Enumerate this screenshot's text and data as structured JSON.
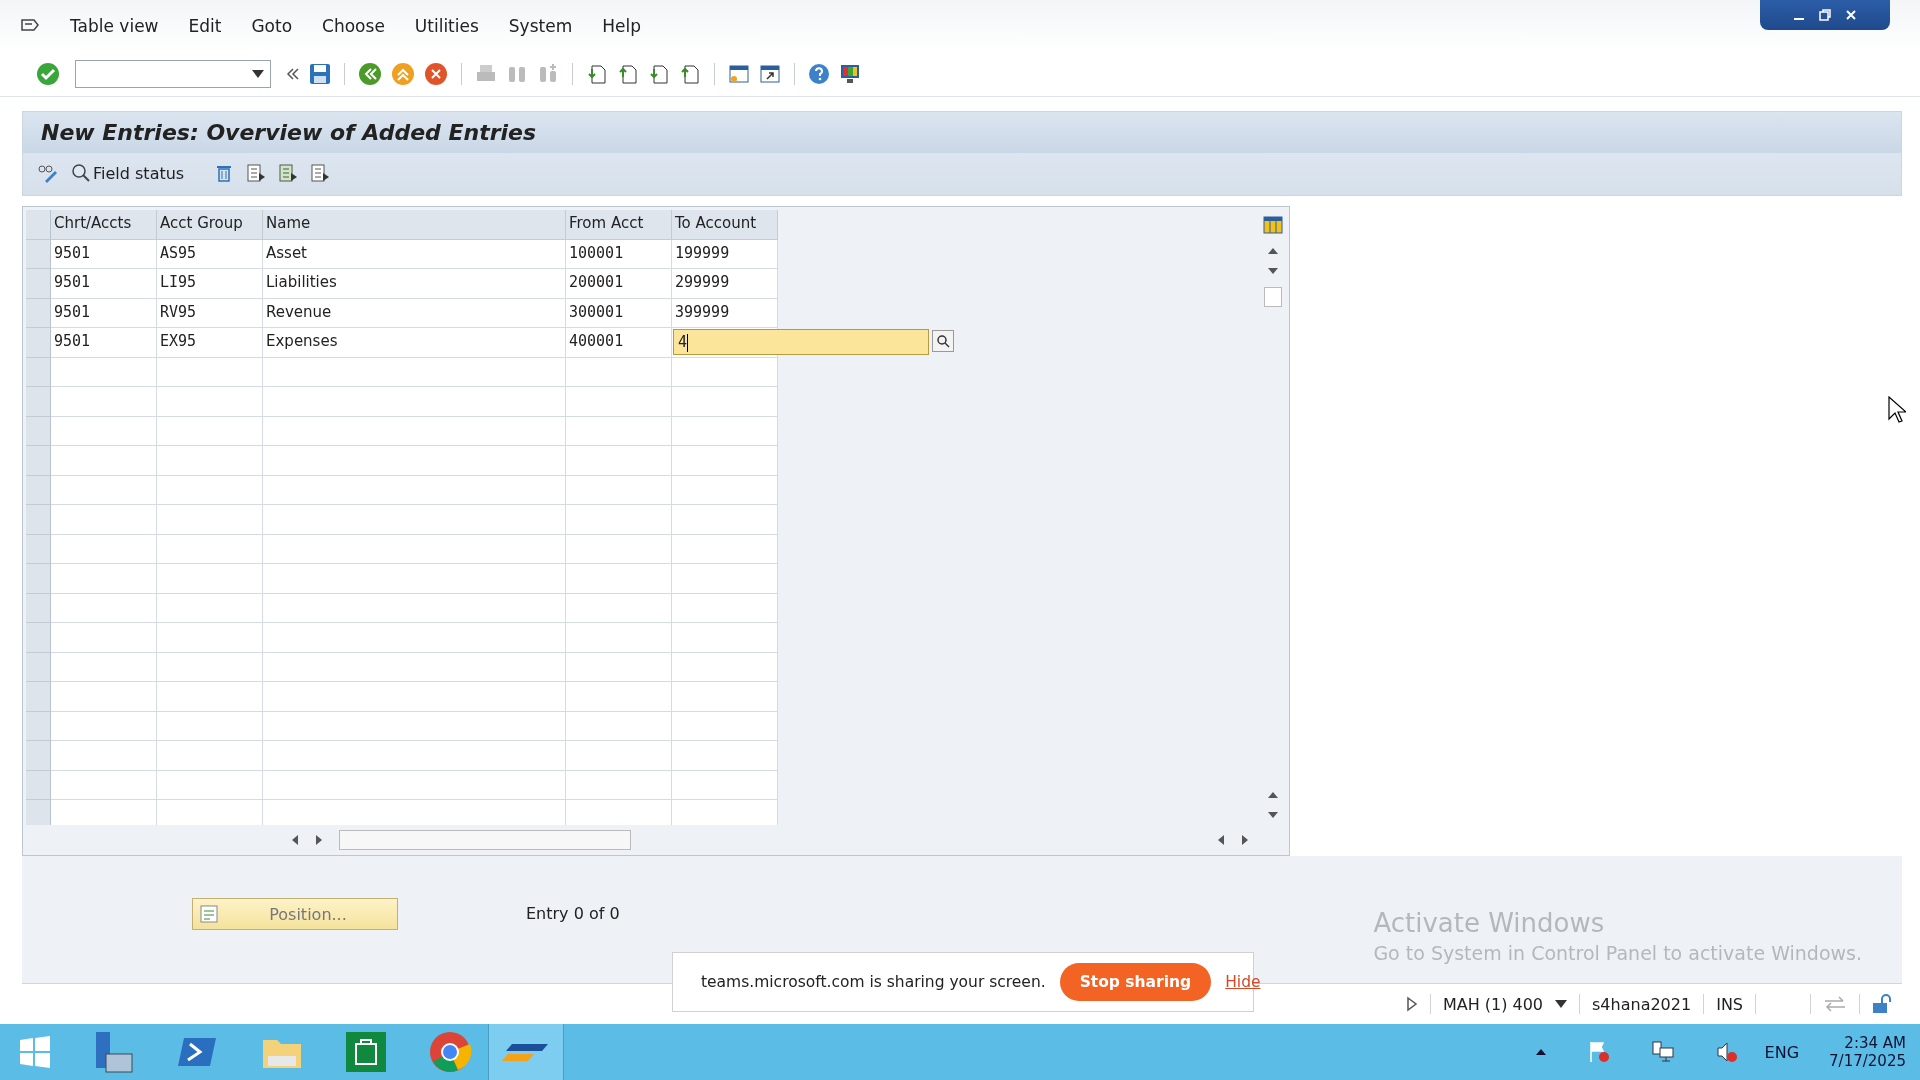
{
  "menu": [
    "Table view",
    "Edit",
    "Goto",
    "Choose",
    "Utilities",
    "System",
    "Help"
  ],
  "screen": {
    "title": "New Entries: Overview of Added Entries",
    "field_status_button": "Field status"
  },
  "table": {
    "columns": [
      "Chrt/Accts",
      "Acct Group",
      "Name",
      "From Acct",
      "To Account"
    ],
    "rows": [
      {
        "cells": [
          "9501",
          "AS95",
          "Asset",
          "100001",
          "199999"
        ],
        "editing": false
      },
      {
        "cells": [
          "9501",
          "LI95",
          "Liabilities",
          "200001",
          "299999"
        ],
        "editing": false
      },
      {
        "cells": [
          "9501",
          "RV95",
          "Revenue",
          "300001",
          "399999"
        ],
        "editing": false
      },
      {
        "cells": [
          "9501",
          "EX95",
          "Expenses",
          "400001",
          "4"
        ],
        "editing": true
      }
    ]
  },
  "position_button": "Position...",
  "entry_count": "Entry 0 of 0",
  "activation_notice": {
    "title": "Activate Windows",
    "text": "Go to System in Control Panel to activate Windows."
  },
  "share_bar": {
    "text": "teams.microsoft.com is sharing your screen.",
    "stop_button": "Stop sharing",
    "hide_link": "Hide"
  },
  "status_bar": {
    "session": "MAH (1) 400",
    "server": "s4hana2021",
    "mode": "INS"
  },
  "taskbar": {
    "language": "ENG",
    "time": "2:34 AM",
    "date": "7/17/2025"
  }
}
